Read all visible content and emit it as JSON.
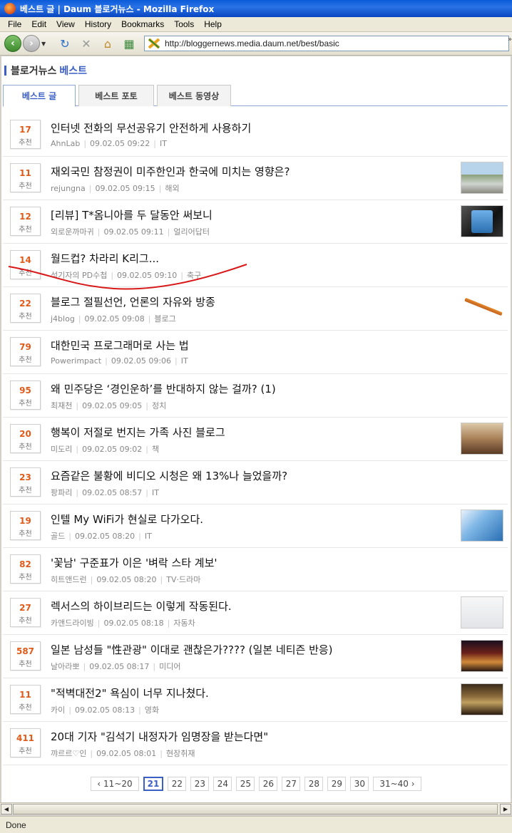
{
  "window": {
    "title": "베스트 글 | Daum 블로거뉴스 - Mozilla Firefox"
  },
  "menu": [
    "File",
    "Edit",
    "View",
    "History",
    "Bookmarks",
    "Tools",
    "Help"
  ],
  "address": {
    "url": "http://bloggernews.media.daum.net/best/basic"
  },
  "site": {
    "title_main": "블로거뉴스",
    "title_accent": "베스트"
  },
  "tabs": [
    "베스트 글",
    "베스트 포토",
    "베스트 동영상"
  ],
  "vote_label": "추천",
  "items": [
    {
      "votes": "17",
      "title": "인터넷 전화의 무선공유기 안전하게 사용하기",
      "author": "AhnLab",
      "date": "09.02.05 09:22",
      "category": "IT",
      "thumb": ""
    },
    {
      "votes": "11",
      "title": "재외국민 참정권이 미주한인과 한국에 미치는 영향은?",
      "author": "rejungna",
      "date": "09.02.05 09:15",
      "category": "해외",
      "thumb": "city"
    },
    {
      "votes": "12",
      "title": "[리뷰] T*옴니아를 두 달동안 써보니",
      "author": "외로운까마귀",
      "date": "09.02.05 09:11",
      "category": "얼리어답터",
      "thumb": "phone"
    },
    {
      "votes": "14",
      "title": "월드컵? 차라리 K리그...",
      "author": "석기자의 PD수첩",
      "date": "09.02.05 09:10",
      "category": "축구",
      "thumb": ""
    },
    {
      "votes": "22",
      "title": "블로그 절필선언, 언론의 자유와 방종",
      "author": "j4blog",
      "date": "09.02.05 09:08",
      "category": "블로그",
      "thumb": "pencil"
    },
    {
      "votes": "79",
      "title": "대한민국 프로그래머로 사는 법",
      "author": "Powerimpact",
      "date": "09.02.05 09:06",
      "category": "IT",
      "thumb": ""
    },
    {
      "votes": "95",
      "title": "왜 민주당은 ‘경인운하’를 반대하지 않는 걸까? (1)",
      "author": "최재천",
      "date": "09.02.05 09:05",
      "category": "정치",
      "thumb": ""
    },
    {
      "votes": "20",
      "title": "행복이 저절로 번지는 가족 사진 블로그",
      "author": "미도리",
      "date": "09.02.05 09:02",
      "category": "책",
      "thumb": "room"
    },
    {
      "votes": "23",
      "title": "요즘같은 불황에 비디오 시청은 왜 13%나 늘었을까?",
      "author": "팡파리",
      "date": "09.02.05 08:57",
      "category": "IT",
      "thumb": ""
    },
    {
      "votes": "19",
      "title": "인텔 My WiFi가 현실로 다가오다.",
      "author": "골드",
      "date": "09.02.05 08:20",
      "category": "IT",
      "thumb": "blue"
    },
    {
      "votes": "82",
      "title": "'꽃남' 구준표가 이은 '벼락 스타 계보'",
      "author": "히트앤드런",
      "date": "09.02.05 08:20",
      "category": "TV·드라마",
      "thumb": ""
    },
    {
      "votes": "27",
      "title": "렉서스의 하이브리드는 이렇게 작동된다.",
      "author": "카앤드라이빙",
      "date": "09.02.05 08:18",
      "category": "자동차",
      "thumb": "white"
    },
    {
      "votes": "587",
      "title": "일본 남성들 \"性관광\" 이대로 괜찮은가???? (일본 네티즌 반응)",
      "author": "날아라뽀",
      "date": "09.02.05 08:17",
      "category": "미디어",
      "thumb": "night"
    },
    {
      "votes": "11",
      "title": "\"적벽대전2\" 욕심이 너무 지나쳤다.",
      "author": "카이",
      "date": "09.02.05 08:13",
      "category": "영화",
      "thumb": "poster"
    },
    {
      "votes": "411",
      "title": "20대 기자 \"김석기 내정자가 임명장을 받는다면\"",
      "author": "꺄르르♡인",
      "date": "09.02.05 08:01",
      "category": "현장취재",
      "thumb": ""
    }
  ],
  "pagination": {
    "prev": "11~20",
    "pages": [
      "21",
      "22",
      "23",
      "24",
      "25",
      "26",
      "27",
      "28",
      "29",
      "30"
    ],
    "current": "21",
    "next": "31~40"
  },
  "status": {
    "text": "Done"
  },
  "colors": {
    "accent": "#3b5fc4",
    "vote": "#e05a1a",
    "annotation": "#d81818"
  }
}
